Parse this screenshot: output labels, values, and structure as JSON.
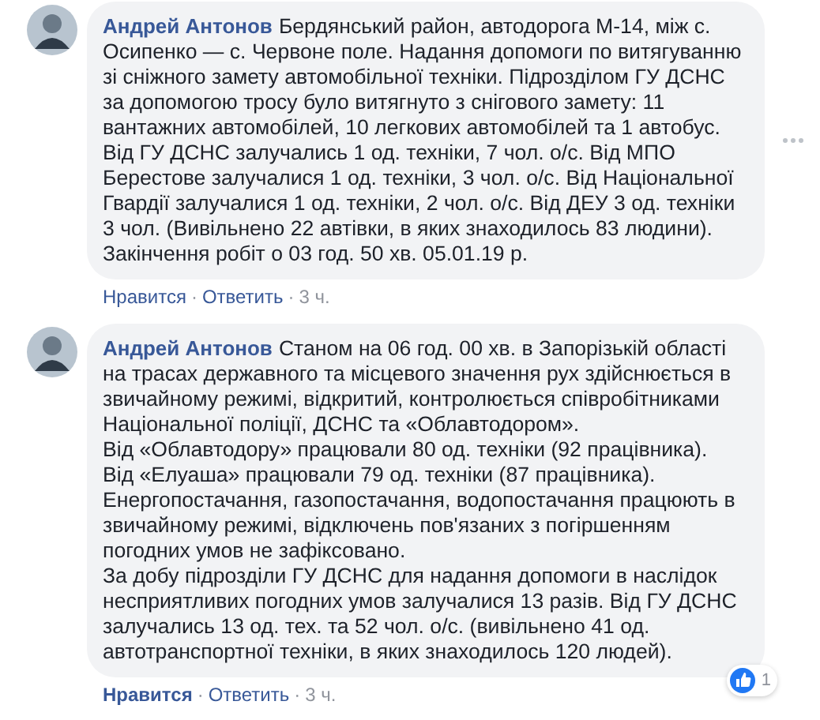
{
  "comments": [
    {
      "author": "Андрей Антонов",
      "paragraphs": [
        "Бердянський район, автодорога М-14, між с. Осипенко — с. Червоне поле. Надання допомоги по витягуванню зі сніжного замету автомобільної техніки. Підрозділом ГУ ДСНС за допомогою тросу було витягнуто з снігового замету: 11 вантажних автомобілей, 10 легкових автомобілей та 1 автобус. Від ГУ ДСНС залучались 1 од. техніки, 7 чол. о/с. Від МПО Берестове залучалися 1 од. техніки, 3 чол. о/с. Від Національної Гвардії залучалися 1 од. техніки, 2 чол. о/с. Від ДЕУ 3 од. техніки 3 чол. (Вивільнено 22 автівки, в яких знаходилось 83 людини). Закінчення робіт о 03 год. 50 хв. 05.01.19 р."
      ],
      "like": "Нравится",
      "liked": false,
      "separator": "·",
      "reply": "Ответить",
      "time": "3 ч.",
      "menu": true
    },
    {
      "author": "Андрей Антонов",
      "paragraphs": [
        "Станом на 06 год. 00 хв. в Запорізькій області на трасах державного та місцевого значення рух здійснюється в звичайному режимі, відкритий, контролюється співробітниками Національної поліції, ДСНС та «Облавтодором».",
        "Від «Облавтодору» працювали 80 од. техніки (92 працівника).",
        "Від «Елуаша» працювали 79 од. техніки (87 працівника).",
        "Енергопостачання, газопостачання, водопостачання працюють в звичайному режимі, відключень пов'язаних з погіршенням погодних умов не зафіксовано.",
        "За добу підрозділи ГУ ДСНС для надання допомоги в наслідок несприятливих погодних умов залучалися 13 разів. Від ГУ ДСНС залучались 13 од. тех. та 52 чол. о/с. (вивільнено 41 од. автотранспортної техніки, в яких знаходилось 120 людей)."
      ],
      "like": "Нравится",
      "liked": true,
      "separator": "·",
      "reply": "Ответить",
      "time": "3 ч.",
      "menu": false,
      "reactions": "1"
    }
  ]
}
